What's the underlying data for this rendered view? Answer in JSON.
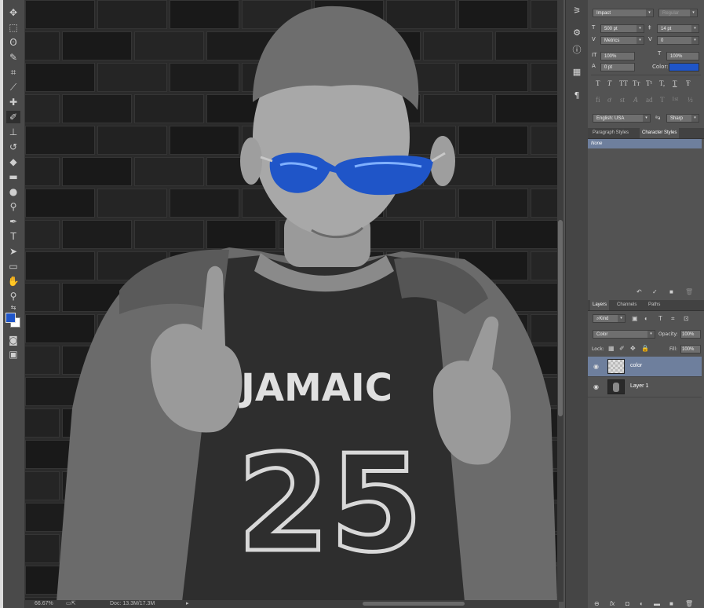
{
  "toolbar": {
    "tools": [
      "move-icon",
      "marquee-icon",
      "lasso-icon",
      "quick-select-icon",
      "crop-icon",
      "eyedropper-icon",
      "spot-heal-icon",
      "brush-icon",
      "stamp-icon",
      "history-brush-icon",
      "eraser-icon",
      "gradient-icon",
      "blur-icon",
      "dodge-icon",
      "pen-icon",
      "type-icon",
      "path-select-icon",
      "rectangle-icon",
      "hand-icon",
      "zoom-icon"
    ],
    "foreground_color": "#1f55c8",
    "background_color": "#ffffff"
  },
  "status": {
    "zoom": "66.67%",
    "doc": "Doc: 13.3M/17.3M"
  },
  "character": {
    "font_family": "Impact",
    "font_style": "Regular",
    "size": "500 pt",
    "leading": "14 pt",
    "kerning": "Metrics",
    "tracking": "0",
    "vertical_scale": "100%",
    "horizontal_scale": "100%",
    "baseline_shift": "0 pt",
    "color_label": "Color:",
    "color": "#1f55c8",
    "language": "English: USA",
    "aa_label": "a",
    "antialias": "Sharp",
    "style_buttons": [
      "T",
      "T",
      "TT",
      "Tт",
      "T¹",
      "T,",
      "T",
      "Ŧ"
    ],
    "opentype_buttons": [
      "fi",
      "ơ",
      "st",
      "A",
      "ad",
      "T",
      "1st",
      "½"
    ]
  },
  "styles": {
    "tabs": [
      "Paragraph Styles",
      "Character Styles"
    ],
    "selected": "None"
  },
  "layers_panel": {
    "tabs": [
      "Layers",
      "Channels",
      "Paths"
    ],
    "filter_kind": "Kind",
    "blend_mode": "Color",
    "opacity_label": "Opacity:",
    "opacity": "100%",
    "lock_label": "Lock:",
    "fill_label": "Fill:",
    "fill": "100%",
    "layers": [
      {
        "name": "color",
        "selected": true
      },
      {
        "name": "Layer 1",
        "selected": false
      }
    ]
  }
}
